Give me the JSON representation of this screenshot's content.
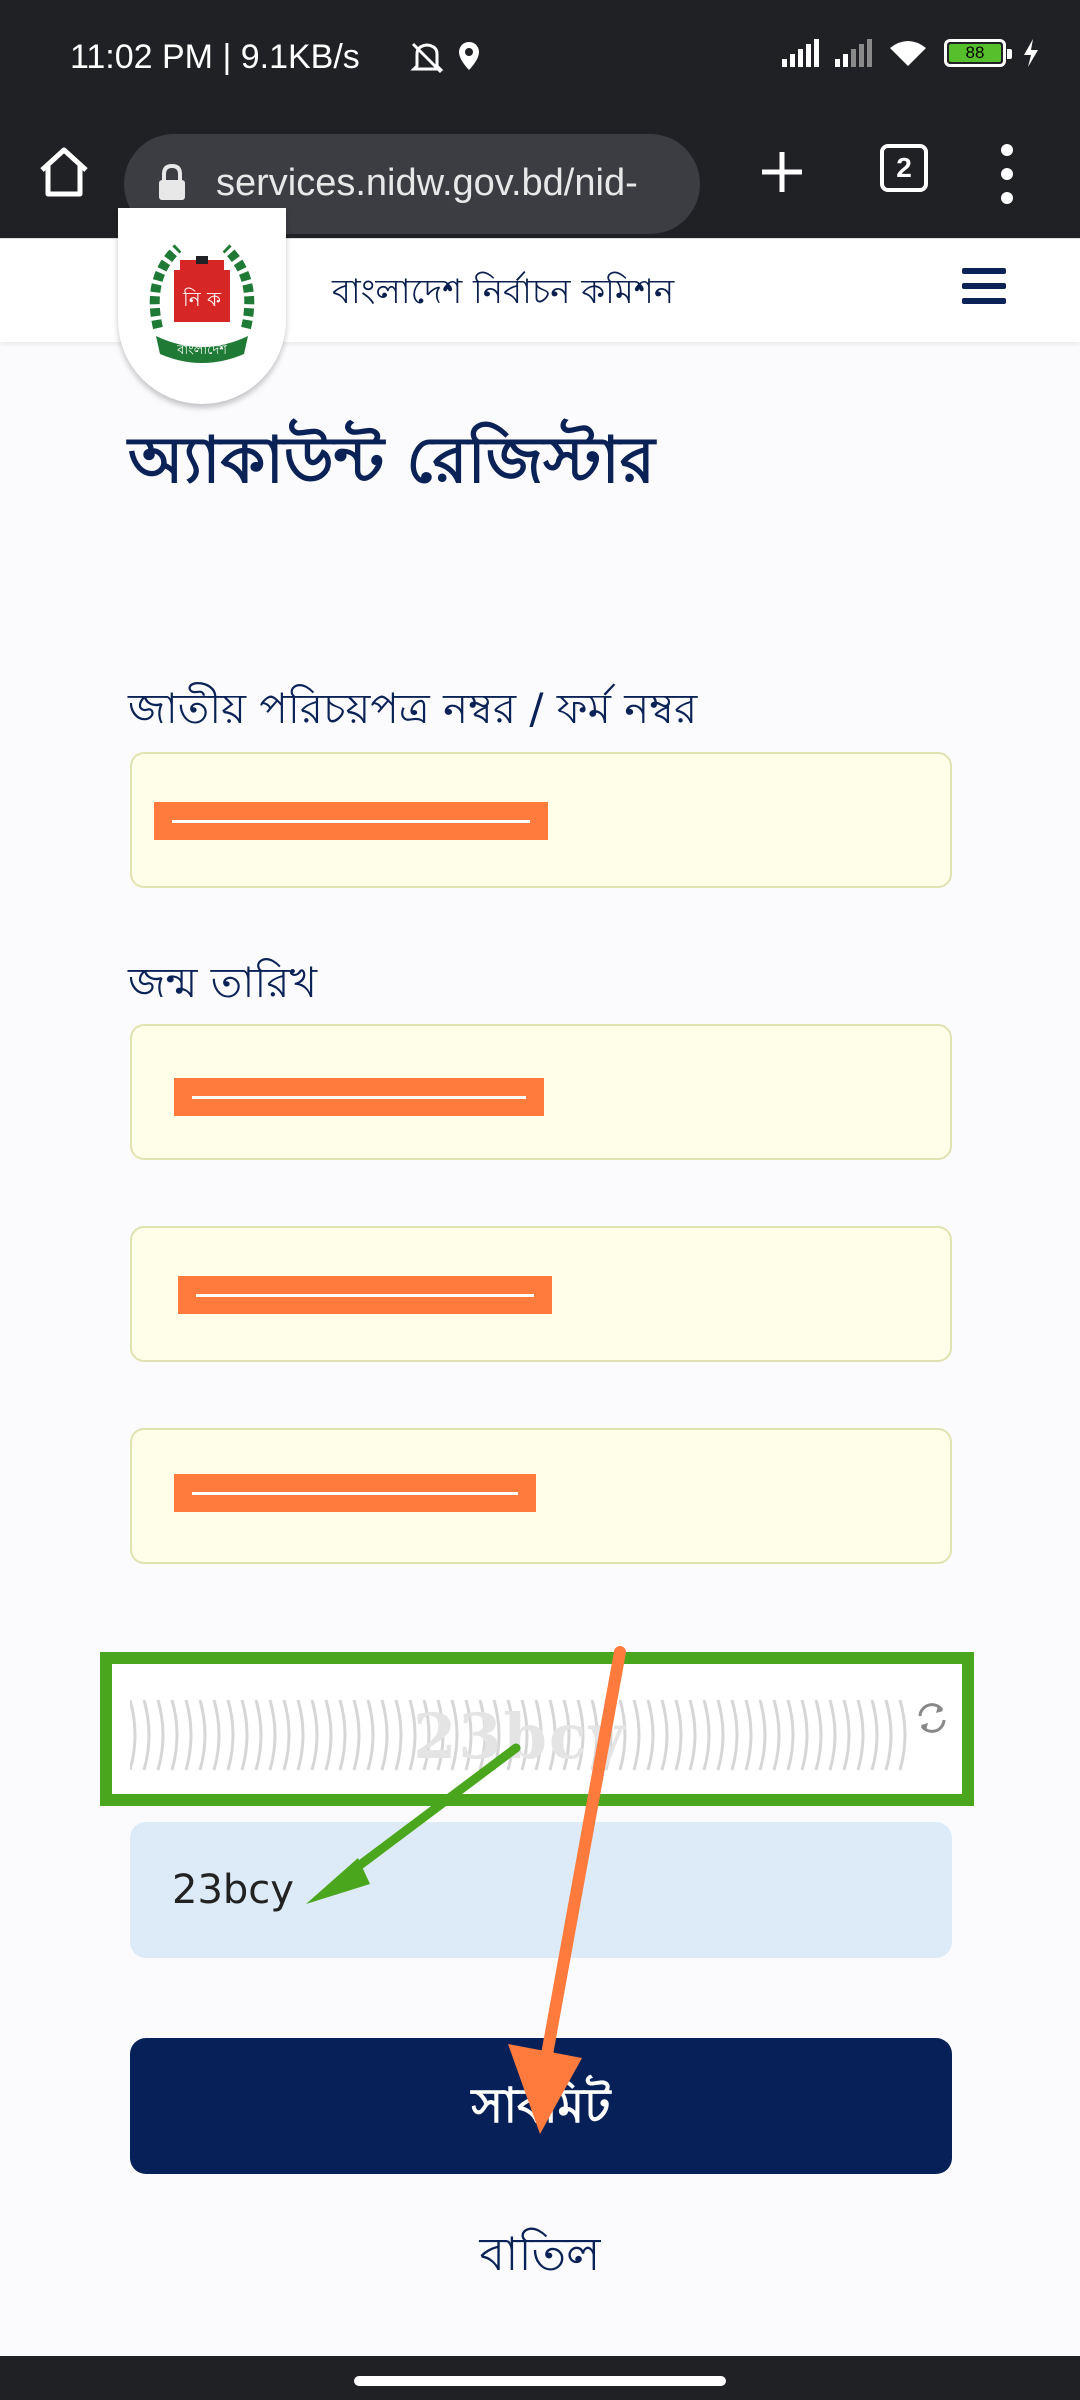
{
  "status_bar": {
    "time": "11:02 PM | 9.1KB/s",
    "battery": "88",
    "icons": [
      "mute-icon",
      "location-icon",
      "signal-icon",
      "signal-icon",
      "wifi-icon",
      "battery-icon",
      "charging-icon"
    ]
  },
  "browser": {
    "url": "services.nidw.gov.bd/nid-",
    "tab_count": "2"
  },
  "site": {
    "title": "বাংলাদেশ নির্বাচন কমিশন",
    "logo_letters": "নি ক",
    "logo_banner": "বাংলাদেশ"
  },
  "form": {
    "page_title": "অ্যাকাউন্ট রেজিস্টার",
    "nid_label": "জাতীয় পরিচয়পত্র নম্বর / ফর্ম নম্বর",
    "dob_label": "জন্ম তারিখ",
    "captcha_text": "23bcy",
    "captcha_input_value": "23bcy",
    "submit_label": "সাবমিট",
    "cancel_label": "বাতিল"
  },
  "colors": {
    "primary": "#072158",
    "highlight_box": "#4aa61c",
    "redaction": "#ff7a3d",
    "arrow_green": "#4aa61c",
    "arrow_orange": "#ff7a3d"
  }
}
